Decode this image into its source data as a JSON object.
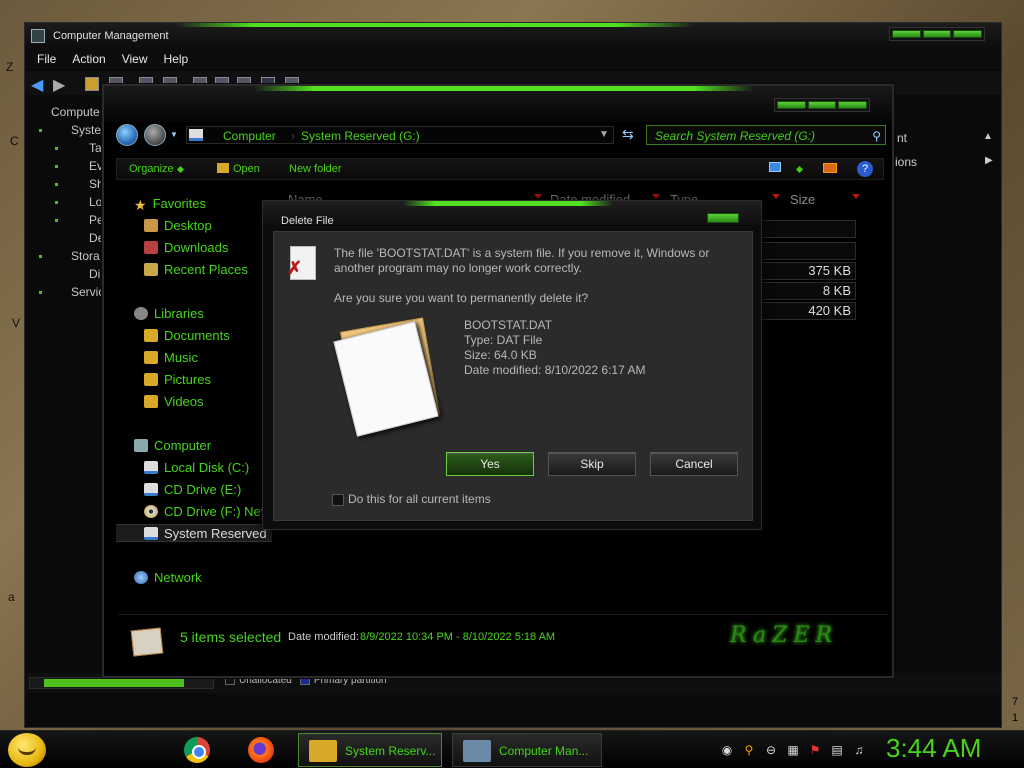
{
  "desktop": {
    "edge_letters": [
      "Z",
      "C",
      "V",
      "a"
    ]
  },
  "computer_management": {
    "title": "Computer Management",
    "menu": [
      "File",
      "Action",
      "View",
      "Help"
    ],
    "tree": [
      "Compute",
      "Syste",
      "Ta",
      "Ev",
      "Sh",
      "Lo",
      "Pe",
      "De",
      "Stora",
      "Di",
      "Servic"
    ],
    "actions": [
      "nt",
      "ions"
    ],
    "legend": [
      "Unallocated",
      "Primary partition"
    ]
  },
  "explorer": {
    "address": {
      "crumbs": [
        "Computer",
        "System Reserved (G:)"
      ],
      "search_placeholder": "Search System Reserved (G:)"
    },
    "command_bar": {
      "organize": "Organize",
      "open": "Open",
      "new_folder": "New folder"
    },
    "nav": {
      "favorites": "Favorites",
      "desktop": "Desktop",
      "downloads": "Downloads",
      "recent_places": "Recent Places",
      "libraries": "Libraries",
      "documents": "Documents",
      "music": "Music",
      "pictures": "Pictures",
      "videos": "Videos",
      "computer": "Computer",
      "local_disk": "Local Disk (C:)",
      "cd_drive_e": "CD Drive (E:)",
      "cd_drive_f": "CD Drive (F:) Nev",
      "system_reserved": "System Reserved",
      "network": "Network"
    },
    "columns": [
      "Name",
      "Date modified",
      "Type",
      "Size"
    ],
    "sizes": [
      "375 KB",
      "8 KB",
      "420 KB"
    ],
    "status": {
      "items_selected": "5 items selected",
      "date_label": "Date modified:",
      "date_range": "8/9/2022 10:34 PM - 8/10/2022 5:18 AM",
      "logo": "RaZER"
    }
  },
  "dialog": {
    "title": "Delete File",
    "warning_line1": "The file 'BOOTSTAT.DAT' is a system file. If you remove it, Windows or",
    "warning_line2": "another program may no longer work correctly.",
    "question": "Are you sure you want to permanently delete it?",
    "file_name": "BOOTSTAT.DAT",
    "file_type": "Type: DAT File",
    "file_size": "Size: 64.0 KB",
    "file_date": "Date modified: 8/10/2022 6:17 AM",
    "yes": "Yes",
    "skip": "Skip",
    "cancel": "Cancel",
    "checkbox_label": "Do this for all current items"
  },
  "taskbar": {
    "task_explorer": "System Reserv...",
    "task_cm": "Computer Man...",
    "clock": "3:44 AM",
    "side_numbers": [
      "7",
      "1"
    ]
  },
  "colors": {
    "accent_green": "#46d41a",
    "bar_green": "#52e020",
    "dialog_bg": "#2b2b2b"
  }
}
